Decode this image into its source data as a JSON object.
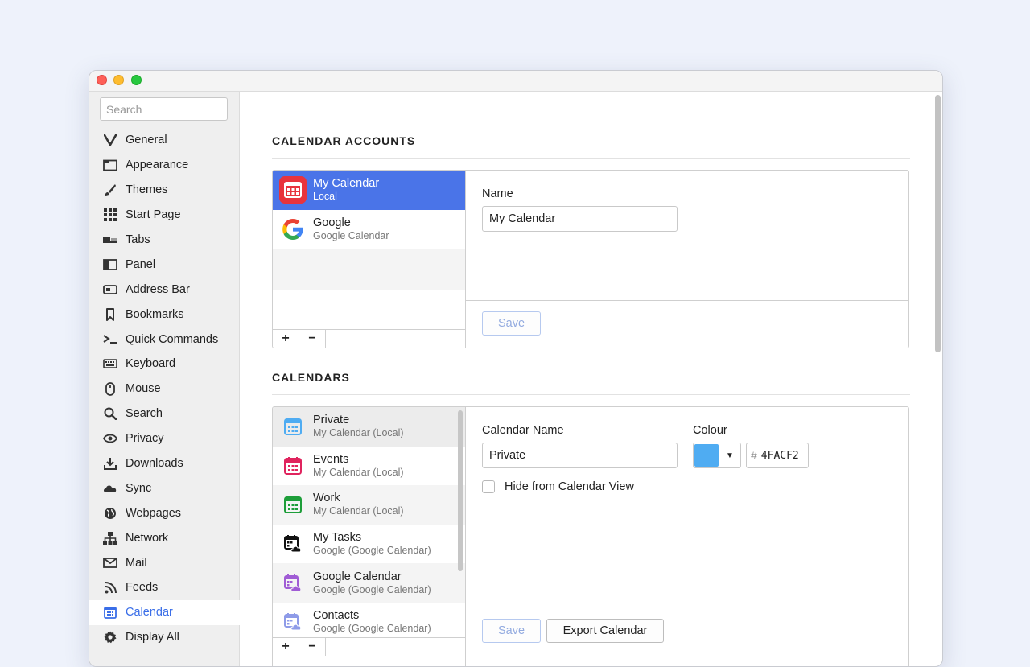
{
  "sidebar": {
    "search_placeholder": "Search",
    "items": [
      {
        "label": "General",
        "icon": "vivaldi-v-icon"
      },
      {
        "label": "Appearance",
        "icon": "folder-window-icon"
      },
      {
        "label": "Themes",
        "icon": "brush-icon"
      },
      {
        "label": "Start Page",
        "icon": "grid-icon"
      },
      {
        "label": "Tabs",
        "icon": "tabs-icon"
      },
      {
        "label": "Panel",
        "icon": "panel-icon"
      },
      {
        "label": "Address Bar",
        "icon": "address-bar-icon"
      },
      {
        "label": "Bookmarks",
        "icon": "bookmark-icon"
      },
      {
        "label": "Quick Commands",
        "icon": "quick-commands-icon"
      },
      {
        "label": "Keyboard",
        "icon": "keyboard-icon"
      },
      {
        "label": "Mouse",
        "icon": "mouse-icon"
      },
      {
        "label": "Search",
        "icon": "magnifier-icon"
      },
      {
        "label": "Privacy",
        "icon": "eye-icon"
      },
      {
        "label": "Downloads",
        "icon": "download-icon"
      },
      {
        "label": "Sync",
        "icon": "cloud-icon"
      },
      {
        "label": "Webpages",
        "icon": "globe-icon"
      },
      {
        "label": "Network",
        "icon": "network-icon"
      },
      {
        "label": "Mail",
        "icon": "mail-icon"
      },
      {
        "label": "Feeds",
        "icon": "rss-icon"
      },
      {
        "label": "Calendar",
        "icon": "calendar-icon"
      },
      {
        "label": "Display All",
        "icon": "gear-icon"
      }
    ]
  },
  "accounts": {
    "title": "CALENDAR ACCOUNTS",
    "items": [
      {
        "name": "My Calendar",
        "sub": "Local"
      },
      {
        "name": "Google",
        "sub": "Google Calendar"
      }
    ],
    "name_label": "Name",
    "name_value": "My Calendar",
    "save_label": "Save",
    "add_label": "+",
    "remove_label": "−"
  },
  "calendars": {
    "title": "CALENDARS",
    "items": [
      {
        "name": "Private",
        "sub": "My Calendar (Local)",
        "color": "#4FACF2"
      },
      {
        "name": "Events",
        "sub": "My Calendar (Local)",
        "color": "#E0245E"
      },
      {
        "name": "Work",
        "sub": "My Calendar (Local)",
        "color": "#1E9E3A"
      },
      {
        "name": "My Tasks",
        "sub": "Google (Google Calendar)",
        "color": "#111111"
      },
      {
        "name": "Google Calendar",
        "sub": "Google (Google Calendar)",
        "color": "#A05CD5"
      },
      {
        "name": "Contacts",
        "sub": "Google (Google Calendar)",
        "color": "#8E9BE8"
      }
    ],
    "name_label": "Calendar Name",
    "name_value": "Private",
    "colour_label": "Colour",
    "colour_hash": "#",
    "colour_hex": "4FACF2",
    "colour_swatch": "#4FACF2",
    "hide_label": "Hide from Calendar View",
    "save_label": "Save",
    "export_label": "Export Calendar",
    "add_label": "+",
    "remove_label": "−"
  }
}
